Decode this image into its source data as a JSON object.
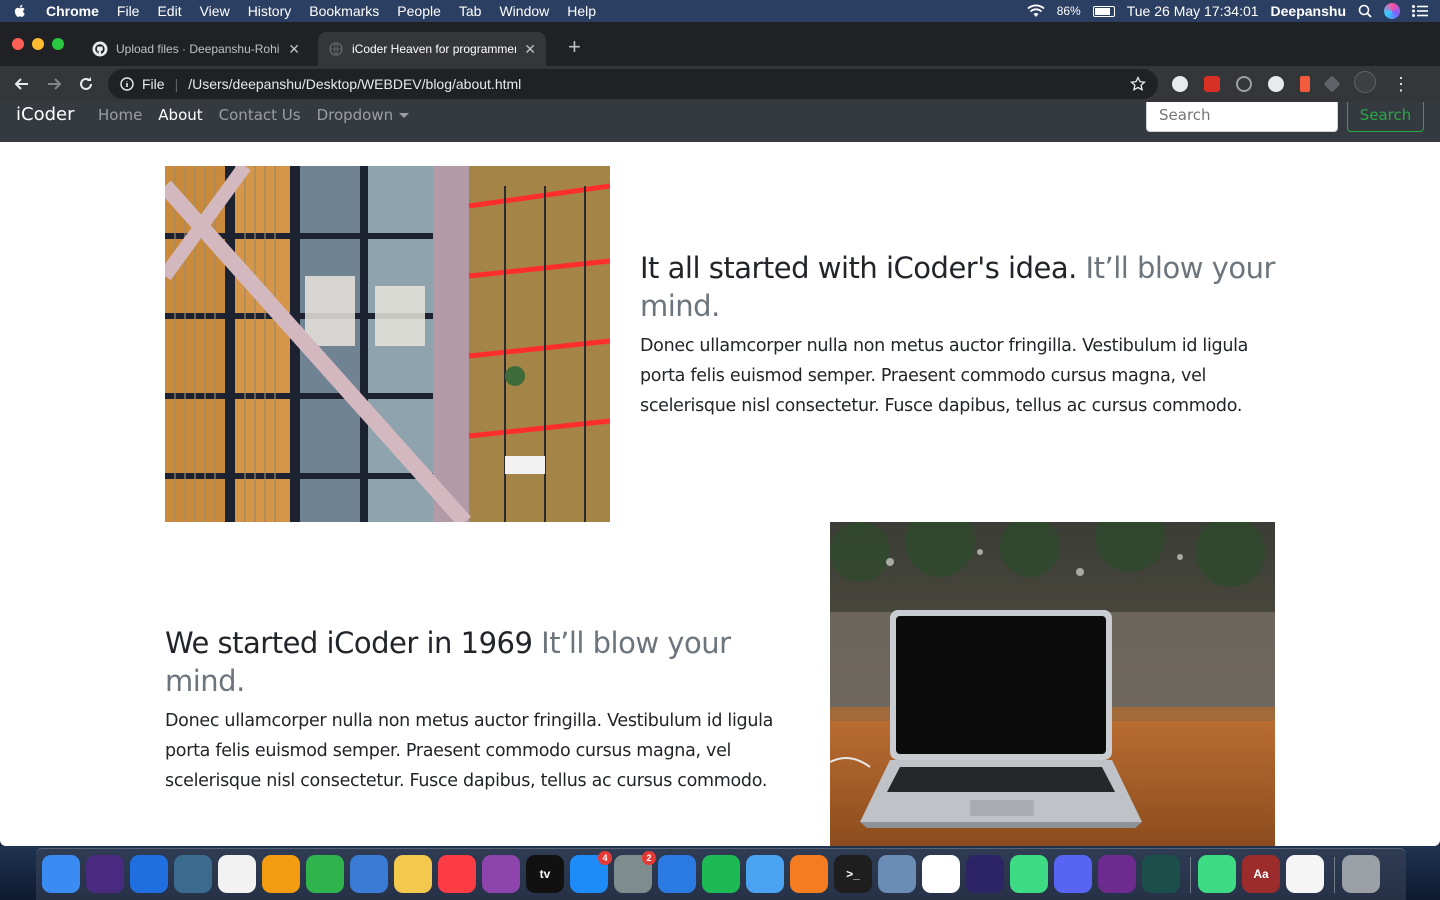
{
  "menubar": {
    "app_name": "Chrome",
    "items": [
      "File",
      "Edit",
      "View",
      "History",
      "Bookmarks",
      "People",
      "Tab",
      "Window",
      "Help"
    ],
    "battery": "86%",
    "battery_level": 0.86,
    "datetime": "Tue 26 May  17:34:01",
    "user": "Deepanshu"
  },
  "browser": {
    "tabs": [
      {
        "title": "Upload files · Deepanshu-Rohilla",
        "active": false,
        "icon": "github-icon"
      },
      {
        "title": "iCoder Heaven for programmers",
        "active": true,
        "icon": "globe-icon"
      }
    ],
    "address": {
      "scheme": "File",
      "url": "/Users/deepanshu/Desktop/WEBDEV/blog/about.html"
    }
  },
  "site": {
    "brand": "iCoder",
    "nav": [
      {
        "label": "Home",
        "active": false
      },
      {
        "label": "About",
        "active": true
      },
      {
        "label": "Contact Us",
        "active": false
      },
      {
        "label": "Dropdown",
        "active": false
      }
    ],
    "search_placeholder": "Search",
    "search_button": "Search"
  },
  "features": [
    {
      "heading": "It all started with iCoder's idea.",
      "heading_muted": "It’ll blow your mind.",
      "body": "Donec ullamcorper nulla non metus auctor fringilla. Vestibulum id ligula porta felis euismod semper. Praesent commodo cursus magna, vel scelerisque nisl consectetur. Fusce dapibus, tellus ac cursus commodo."
    },
    {
      "heading": "We started iCoder in 1969",
      "heading_muted": "It’ll blow your mind.",
      "body": "Donec ullamcorper nulla non metus auctor fringilla. Vestibulum id ligula porta felis euismod semper. Praesent commodo cursus magna, vel scelerisque nisl consectetur. Fusce dapibus, tellus ac cursus commodo."
    }
  ],
  "dock": {
    "apps": [
      {
        "name": "finder-icon",
        "label": ""
      },
      {
        "name": "siri-icon",
        "label": ""
      },
      {
        "name": "safari-icon",
        "label": ""
      },
      {
        "name": "preview-icon",
        "label": ""
      },
      {
        "name": "photos-icon",
        "label": ""
      },
      {
        "name": "pages-icon",
        "label": ""
      },
      {
        "name": "numbers-icon",
        "label": ""
      },
      {
        "name": "keynote-icon",
        "label": ""
      },
      {
        "name": "python-icon",
        "label": ""
      },
      {
        "name": "music-icon",
        "label": ""
      },
      {
        "name": "podcasts-icon",
        "label": ""
      },
      {
        "name": "apple-tv-icon",
        "label": "tv"
      },
      {
        "name": "app-store-icon",
        "label": "",
        "badge": "4"
      },
      {
        "name": "system-preferences-icon",
        "label": "",
        "badge": "2"
      },
      {
        "name": "vscode-icon",
        "label": ""
      },
      {
        "name": "spotify-icon",
        "label": ""
      },
      {
        "name": "xcode-icon",
        "label": ""
      },
      {
        "name": "sublime-text-icon",
        "label": ""
      },
      {
        "name": "terminal-icon",
        "label": ">_"
      },
      {
        "name": "image-capture-icon",
        "label": ""
      },
      {
        "name": "chrome-icon",
        "label": ""
      },
      {
        "name": "eclipse-icon",
        "label": ""
      },
      {
        "name": "android-studio-icon",
        "label": ""
      },
      {
        "name": "discord-icon",
        "label": ""
      },
      {
        "name": "github-desktop-icon",
        "label": ""
      },
      {
        "name": "gitkraken-icon",
        "label": ""
      },
      {
        "name": "android-icon",
        "label": ""
      },
      {
        "name": "dictionary-icon",
        "label": "Aa"
      },
      {
        "name": "textedit-icon",
        "label": ""
      },
      {
        "name": "trash-icon",
        "label": ""
      }
    ]
  }
}
